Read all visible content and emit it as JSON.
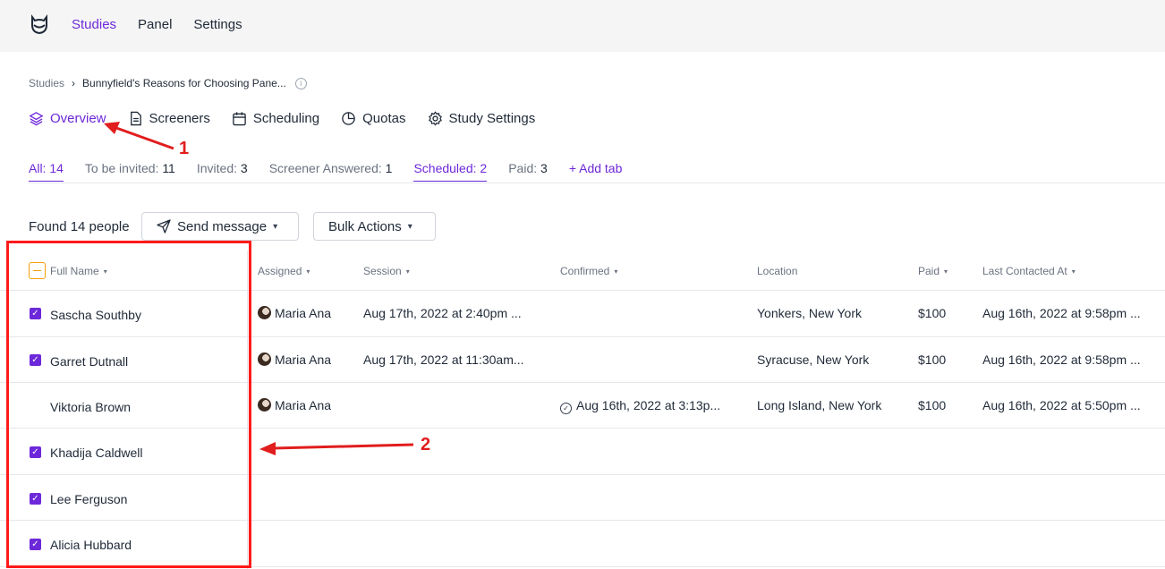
{
  "topnav": {
    "items": [
      "Studies",
      "Panel",
      "Settings"
    ],
    "active": "Studies"
  },
  "breadcrumb": {
    "root": "Studies",
    "separator": "›",
    "current": "Bunnyfield's Reasons for Choosing Pane...",
    "info_icon": "info-icon"
  },
  "section_tabs": [
    {
      "label": "Overview",
      "icon": "layers-icon"
    },
    {
      "label": "Screeners",
      "icon": "document-icon"
    },
    {
      "label": "Scheduling",
      "icon": "calendar-icon"
    },
    {
      "label": "Quotas",
      "icon": "pie-chart-icon"
    },
    {
      "label": "Study Settings",
      "icon": "gear-icon"
    }
  ],
  "filter_tabs": [
    {
      "label": "All:",
      "count": "14"
    },
    {
      "label": "To be invited:",
      "count": "11"
    },
    {
      "label": "Invited:",
      "count": "3"
    },
    {
      "label": "Screener Answered:",
      "count": "1"
    },
    {
      "label": "Scheduled:",
      "count": "2"
    },
    {
      "label": "Paid:",
      "count": "3"
    }
  ],
  "add_tab_label": "+ Add tab",
  "toolbar": {
    "found": "Found 14 people",
    "send_message": "Send message",
    "bulk_actions": "Bulk Actions"
  },
  "table": {
    "columns": [
      "Full Name",
      "Assigned",
      "Session",
      "Confirmed",
      "Location",
      "Paid",
      "Last Contacted At"
    ],
    "rows": [
      {
        "name": "Sascha Southby",
        "checked": true,
        "assigned": "Maria Ana",
        "session": "Aug 17th, 2022 at 2:40pm ...",
        "confirmed": "",
        "location": "Yonkers, New York",
        "paid": "$100",
        "last_contacted": "Aug 16th, 2022 at 9:58pm ..."
      },
      {
        "name": "Garret Dutnall",
        "checked": true,
        "assigned": "Maria Ana",
        "session": "Aug 17th, 2022 at 11:30am...",
        "confirmed": "",
        "location": "Syracuse, New York",
        "paid": "$100",
        "last_contacted": "Aug 16th, 2022 at 9:58pm ..."
      },
      {
        "name": "Viktoria Brown",
        "checked": false,
        "assigned": "Maria Ana",
        "session": "",
        "confirmed": "Aug 16th, 2022 at 3:13p...",
        "location": "Long Island, New York",
        "paid": "$100",
        "last_contacted": "Aug 16th, 2022 at 5:50pm ..."
      },
      {
        "name": "Khadija Caldwell",
        "checked": true,
        "assigned": "",
        "session": "",
        "confirmed": "",
        "location": "",
        "paid": "",
        "last_contacted": ""
      },
      {
        "name": "Lee Ferguson",
        "checked": true,
        "assigned": "",
        "session": "",
        "confirmed": "",
        "location": "",
        "paid": "",
        "last_contacted": ""
      },
      {
        "name": "Alicia Hubbard",
        "checked": true,
        "assigned": "",
        "session": "",
        "confirmed": "",
        "location": "",
        "paid": "",
        "last_contacted": ""
      }
    ]
  },
  "annotations": {
    "label_1": "1",
    "label_2": "2",
    "color": "#e11d1d"
  },
  "colors": {
    "accent": "#6d28d9",
    "annotation": "#ff1a1a"
  }
}
